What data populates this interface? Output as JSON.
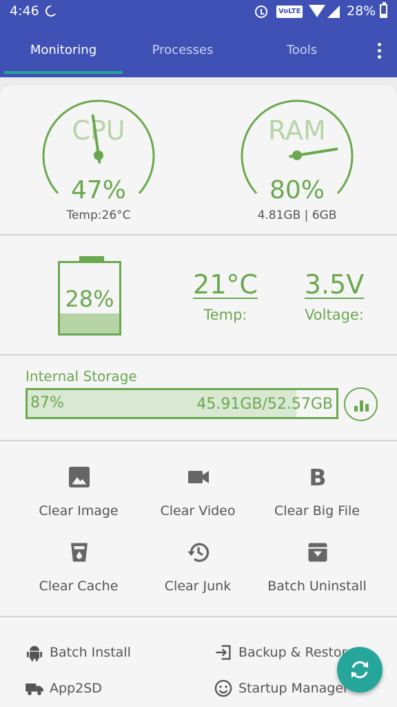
{
  "status_bar": {
    "time": "4:46",
    "network_badge": "VoLTE",
    "battery": "28%"
  },
  "tabs": [
    {
      "label": "Monitoring",
      "active": true
    },
    {
      "label": "Processes",
      "active": false
    },
    {
      "label": "Tools",
      "active": false
    }
  ],
  "cpu": {
    "label": "CPU",
    "value": "47%",
    "sub": "Temp:26°C",
    "level": 0.47
  },
  "ram": {
    "label": "RAM",
    "value": "80%",
    "sub": "4.81GB | 6GB",
    "level": 0.8
  },
  "battery": {
    "percent": "28%",
    "level": 0.28
  },
  "battery_temp": {
    "value": "21°C",
    "label": "Temp:"
  },
  "battery_voltage": {
    "value": "3.5V",
    "label": "Voltage:"
  },
  "storage": {
    "title": "Internal Storage",
    "percent": "87%",
    "size": "45.91GB/52.57GB",
    "level": 0.87
  },
  "tools": [
    {
      "label": "Clear Image",
      "icon": "image-icon"
    },
    {
      "label": "Clear Video",
      "icon": "video-icon"
    },
    {
      "label": "Clear Big File",
      "icon": "bold-b-icon"
    },
    {
      "label": "Clear Cache",
      "icon": "cache-cup-icon"
    },
    {
      "label": "Clear Junk",
      "icon": "history-icon"
    },
    {
      "label": "Batch Uninstall",
      "icon": "archive-icon"
    }
  ],
  "bottom_menu": [
    {
      "label": "Batch Install",
      "icon": "android-icon"
    },
    {
      "label": "Backup & Restore",
      "icon": "login-arrow-icon"
    },
    {
      "label": "App2SD",
      "icon": "truck-icon"
    },
    {
      "label": "Startup Manager",
      "icon": "smiley-icon"
    }
  ],
  "colors": {
    "header": "#3f51b5",
    "accent_green": "#6aa84f",
    "fab": "#26a69a"
  }
}
